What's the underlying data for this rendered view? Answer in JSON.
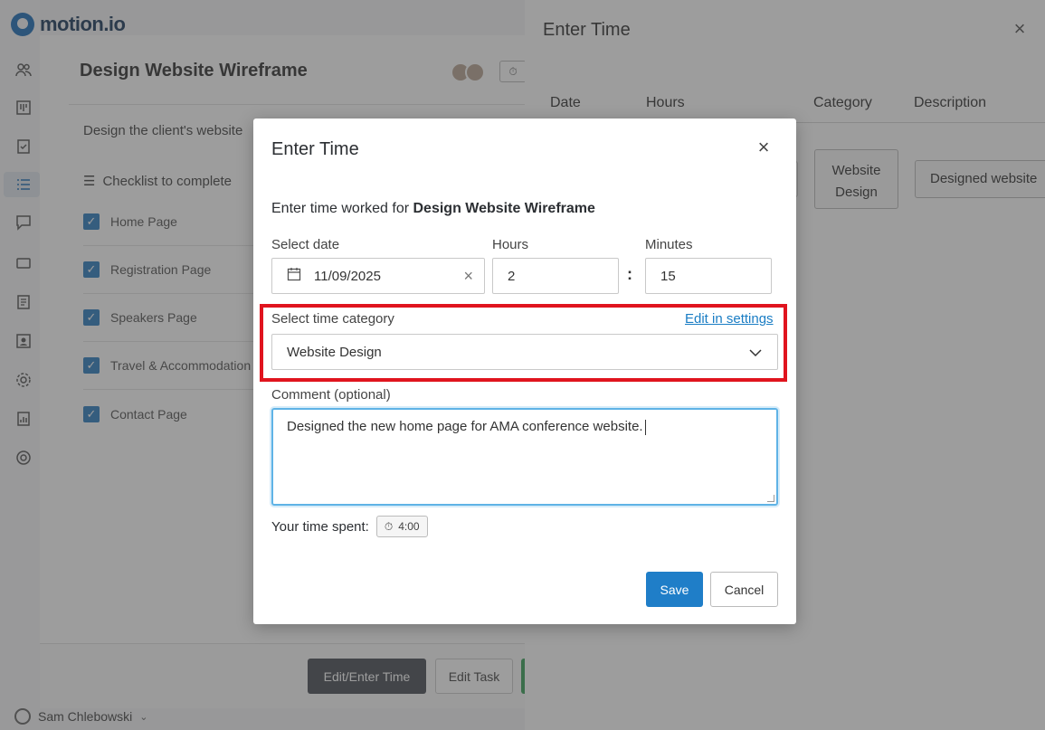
{
  "app": {
    "logo_text": "motion.io"
  },
  "sidebar": {
    "icons": [
      "people-icon",
      "board-icon",
      "clipboard-icon",
      "list-icon",
      "chat-icon",
      "card-icon",
      "document-icon",
      "contact-icon",
      "gear-icon",
      "report-icon",
      "help-icon"
    ],
    "user_name": "Sam Chlebowski"
  },
  "task": {
    "title": "Design Website Wireframe",
    "description": "Design the client's website",
    "checklist_title": "Checklist to complete",
    "checklist": [
      {
        "label": "Home Page",
        "checked": true
      },
      {
        "label": "Registration Page",
        "checked": true
      },
      {
        "label": "Speakers Page",
        "checked": true
      },
      {
        "label": "Travel & Accommodation l",
        "checked": true
      },
      {
        "label": "Contact Page",
        "checked": true
      }
    ],
    "edit_enter_time_label": "Edit/Enter Time",
    "edit_task_label": "Edit Task"
  },
  "time_panel": {
    "title": "Enter Time",
    "columns": {
      "date": "Date",
      "hours": "Hours",
      "category": "Category",
      "description": "Description"
    },
    "entry": {
      "category": "Website Design",
      "description": "Designed website"
    }
  },
  "modal": {
    "title": "Enter Time",
    "intro_prefix": "Enter time worked for ",
    "intro_task": "Design Website Wireframe",
    "date_label": "Select date",
    "date_value": "11/09/2025",
    "hours_label": "Hours",
    "hours_value": "2",
    "minutes_label": "Minutes",
    "minutes_value": "15",
    "separator": ":",
    "category_label": "Select time category",
    "settings_link": "Edit in settings",
    "category_value": "Website Design",
    "comment_label": "Comment (optional)",
    "comment_value": "Designed the new home page for AMA conference website.",
    "time_spent_label": "Your time spent:",
    "time_spent_value": "4:00",
    "save_label": "Save",
    "cancel_label": "Cancel"
  },
  "colors": {
    "primary": "#1f7ec8",
    "highlight": "#e0141e",
    "focus": "#5fb3e6",
    "checkbox": "#2f7fc1"
  }
}
